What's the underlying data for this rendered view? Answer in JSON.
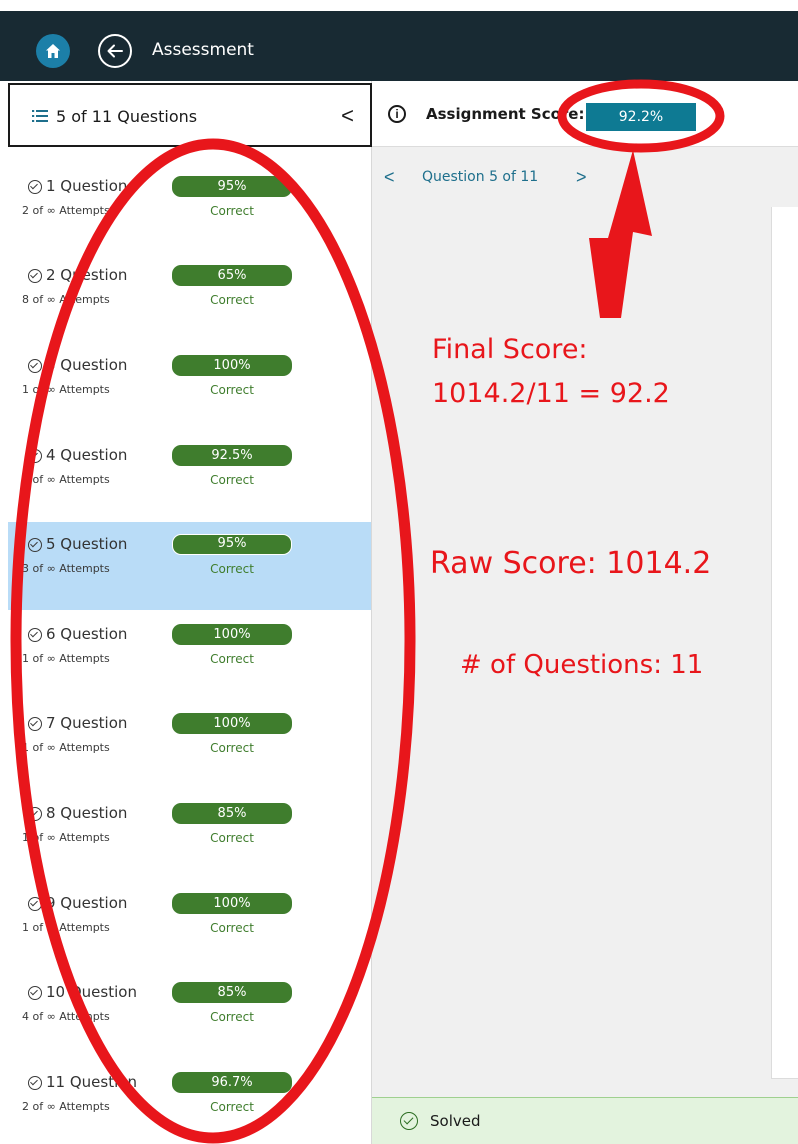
{
  "header": {
    "title": "Assessment",
    "home_icon": "home-icon",
    "back_icon": "back-arrow-icon",
    "bg_color": "#182a33"
  },
  "sidebar": {
    "count_label": "5 of 11 Questions",
    "collapse_label": "<",
    "list_icon": "list-icon",
    "questions": [
      {
        "title": "1 Question",
        "attempts": "2 of ∞ Attempts",
        "score": "95%",
        "status": "Correct"
      },
      {
        "title": "2 Question",
        "attempts": "8 of ∞ Attempts",
        "score": "65%",
        "status": "Correct"
      },
      {
        "title": "3 Question",
        "attempts": "1 of ∞ Attempts",
        "score": "100%",
        "status": "Correct"
      },
      {
        "title": "4 Question",
        "attempts": "1 of ∞ Attempts",
        "score": "92.5%",
        "status": "Correct"
      },
      {
        "title": "5 Question",
        "attempts": "3 of ∞ Attempts",
        "score": "95%",
        "status": "Correct"
      },
      {
        "title": "6 Question",
        "attempts": "1 of ∞ Attempts",
        "score": "100%",
        "status": "Correct"
      },
      {
        "title": "7 Question",
        "attempts": "1 of ∞ Attempts",
        "score": "100%",
        "status": "Correct"
      },
      {
        "title": "8 Question",
        "attempts": "1 of ∞ Attempts",
        "score": "85%",
        "status": "Correct"
      },
      {
        "title": "9 Question",
        "attempts": "1 of ∞ Attempts",
        "score": "100%",
        "status": "Correct"
      },
      {
        "title": "10 Question",
        "attempts": "4 of ∞ Attempts",
        "score": "85%",
        "status": "Correct"
      },
      {
        "title": "11 Question",
        "attempts": "2 of ∞ Attempts",
        "score": "96.7%",
        "status": "Correct"
      }
    ],
    "selected_index": 4,
    "score_color": "#3f7d2d",
    "selected_color": "#b9dcf7"
  },
  "main": {
    "score_label": "Assignment Score:",
    "score_value": "92.2%",
    "score_badge_color": "#0e7a93",
    "nav_prev": "<",
    "nav_label": "Question 5 of 11",
    "nav_next": ">",
    "solved_label": "Solved"
  },
  "annotations": {
    "final_line1": "Final Score:",
    "final_line2": "1014.2/11 = 92.2",
    "raw": "Raw Score: 1014.2",
    "num_questions": "# of Questions: 11",
    "color": "#e8161b"
  }
}
